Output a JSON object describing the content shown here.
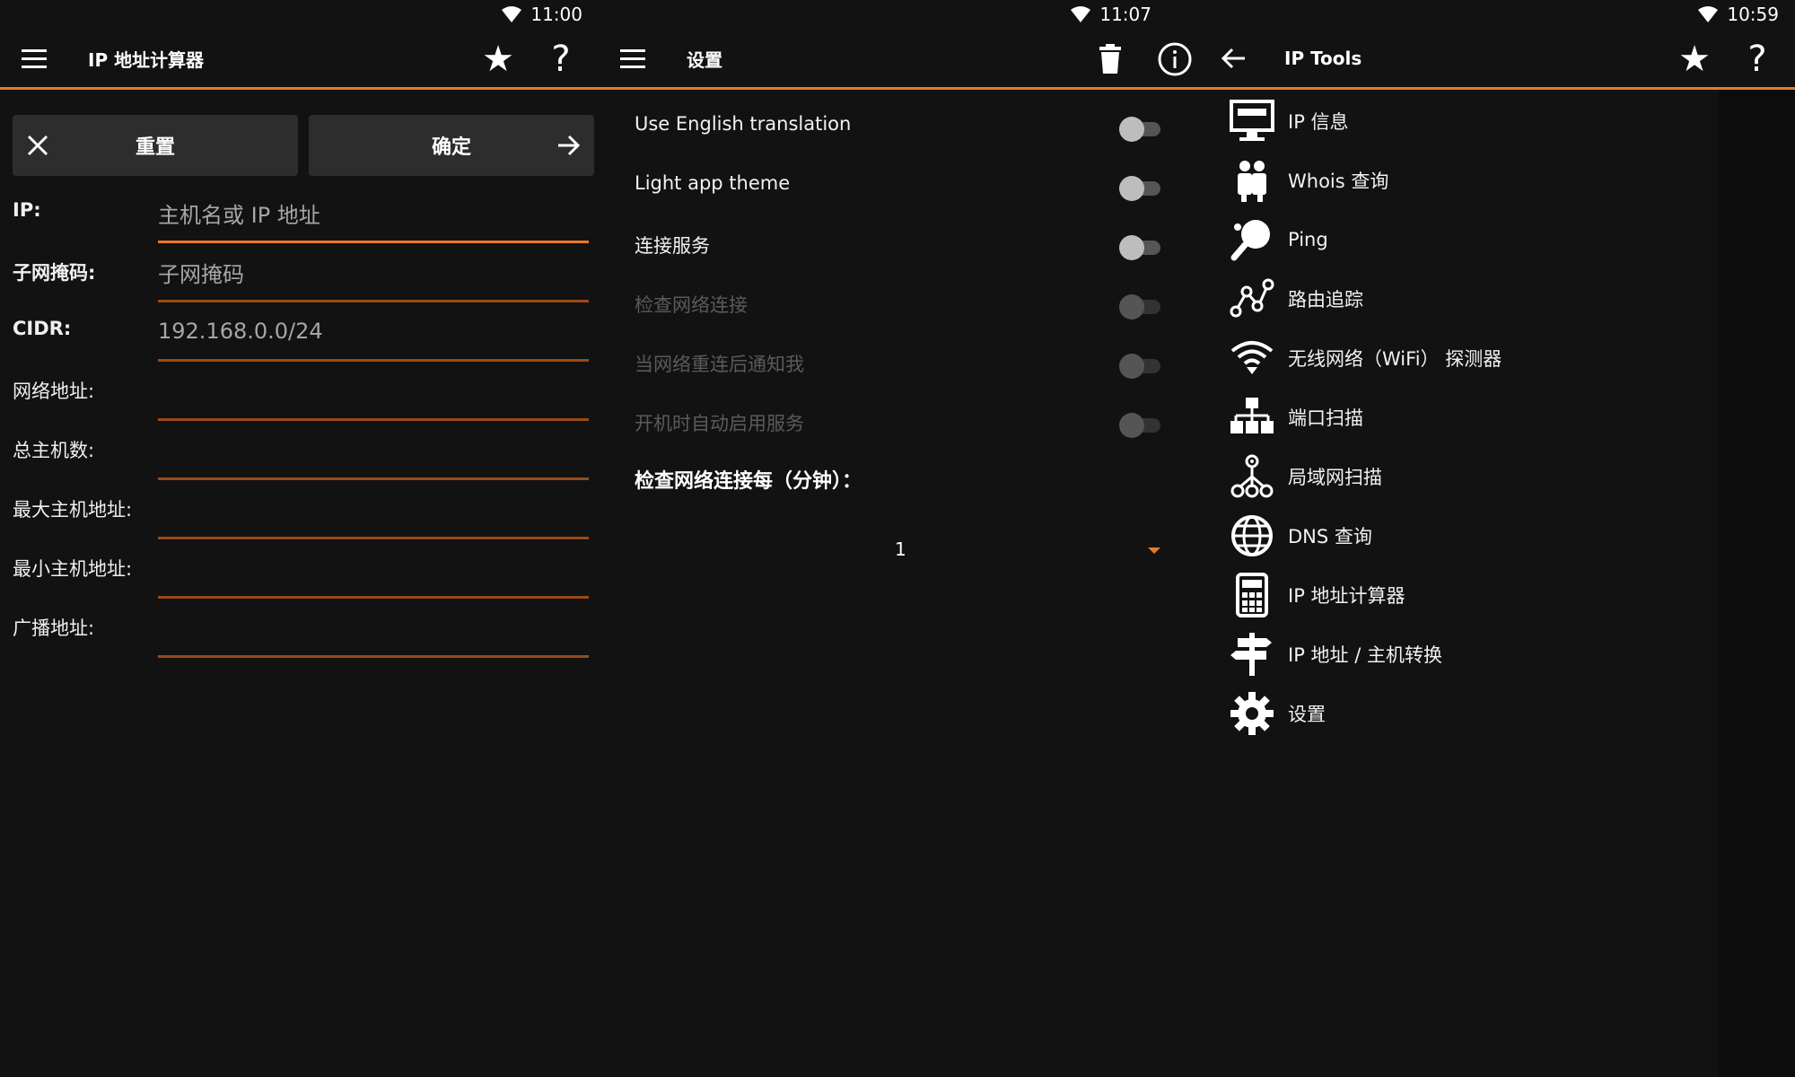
{
  "panel1": {
    "status": {
      "time": "11:00"
    },
    "appbar": {
      "title": "IP 地址计算器"
    },
    "buttons": {
      "reset": "重置",
      "confirm": "确定"
    },
    "fields": [
      {
        "label": "IP:",
        "value": "主机名或 IP 地址"
      },
      {
        "label": "子网掩码:",
        "value": "子网掩码"
      },
      {
        "label": "CIDR:",
        "value": "192.168.0.0/24"
      },
      {
        "label": "网络地址:",
        "value": ""
      },
      {
        "label": "总主机数:",
        "value": ""
      },
      {
        "label": "最大主机地址:",
        "value": ""
      },
      {
        "label": "最小主机地址:",
        "value": ""
      },
      {
        "label": "广播地址:",
        "value": ""
      }
    ]
  },
  "panel2": {
    "status": {
      "time": "11:07"
    },
    "appbar": {
      "title": "设置"
    },
    "settings": [
      {
        "label": "Use English translation",
        "enabled": true
      },
      {
        "label": "Light app theme",
        "enabled": true
      },
      {
        "label": "连接服务",
        "enabled": true
      },
      {
        "label": "检查网络连接",
        "enabled": false
      },
      {
        "label": "当网络重连后通知我",
        "enabled": false
      },
      {
        "label": "开机时自动启用服务",
        "enabled": false
      }
    ],
    "interval": {
      "label": "检查网络连接每（分钟）：",
      "value": "1"
    }
  },
  "panel3": {
    "status": {
      "time": "10:59"
    },
    "appbar": {
      "title": "IP Tools"
    },
    "tools": [
      {
        "label": "IP 信息",
        "icon": "monitor-icon"
      },
      {
        "label": "Whois 查询",
        "icon": "people-icon"
      },
      {
        "label": "Ping",
        "icon": "ping-pong-icon"
      },
      {
        "label": "路由追踪",
        "icon": "route-icon"
      },
      {
        "label": "无线网络（WiFi） 探测器",
        "icon": "wifi-icon"
      },
      {
        "label": "端口扫描",
        "icon": "network-blocks-icon"
      },
      {
        "label": "局域网扫描",
        "icon": "lan-icon"
      },
      {
        "label": "DNS 查询",
        "icon": "globe-icon"
      },
      {
        "label": "IP 地址计算器",
        "icon": "calculator-icon"
      },
      {
        "label": "IP 地址 / 主机转换",
        "icon": "signpost-icon"
      },
      {
        "label": "设置",
        "icon": "gear-icon"
      }
    ]
  },
  "colors": {
    "background": "#121212",
    "accent": "#e8782a",
    "button": "#2d2d2d"
  }
}
